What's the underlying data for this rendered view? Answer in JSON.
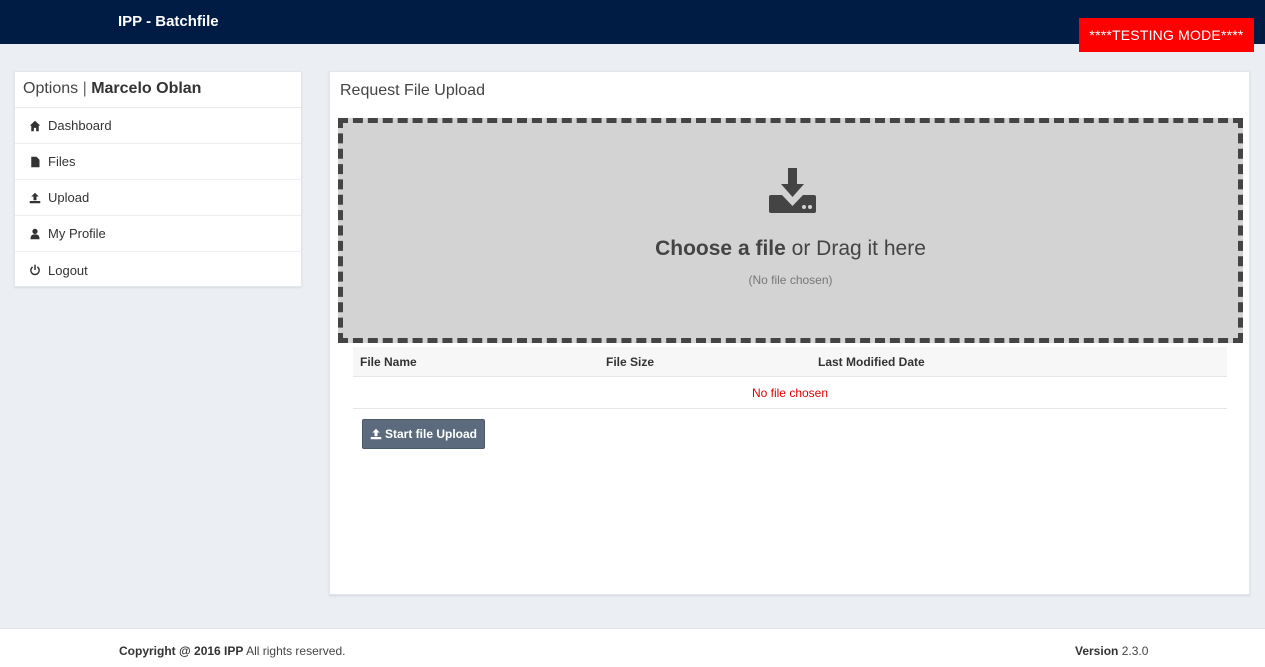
{
  "header": {
    "brand": "IPP - Batchfile",
    "testing_badge": "****TESTING MODE****"
  },
  "sidebar": {
    "title_prefix": "Options",
    "separator": "|",
    "user_name": "Marcelo Oblan",
    "items": [
      {
        "label": "Dashboard",
        "icon": "home-icon"
      },
      {
        "label": "Files",
        "icon": "file-icon"
      },
      {
        "label": "Upload",
        "icon": "upload-icon"
      },
      {
        "label": "My Profile",
        "icon": "user-icon"
      },
      {
        "label": "Logout",
        "icon": "power-icon"
      }
    ]
  },
  "main": {
    "title": "Request File Upload",
    "dropzone": {
      "choose_bold": "Choose a file",
      "choose_rest": "or Drag it here",
      "status": "(No file chosen)",
      "icon": "download-drive-icon"
    },
    "table": {
      "columns": [
        "File Name",
        "File Size",
        "Last Modified Date"
      ],
      "empty_message": "No file chosen"
    },
    "start_button": "Start file Upload"
  },
  "footer": {
    "copyright_bold": "Copyright @ 2016 IPP",
    "copyright_rest": "All rights reserved.",
    "version_label": "Version",
    "version_value": "2.3.0"
  },
  "colors": {
    "topbar": "#001c44",
    "testing_badge": "#ff0000",
    "dropzone_bg": "#d3d3d3",
    "button": "#5b6b7d",
    "empty_message": "#e00000"
  }
}
